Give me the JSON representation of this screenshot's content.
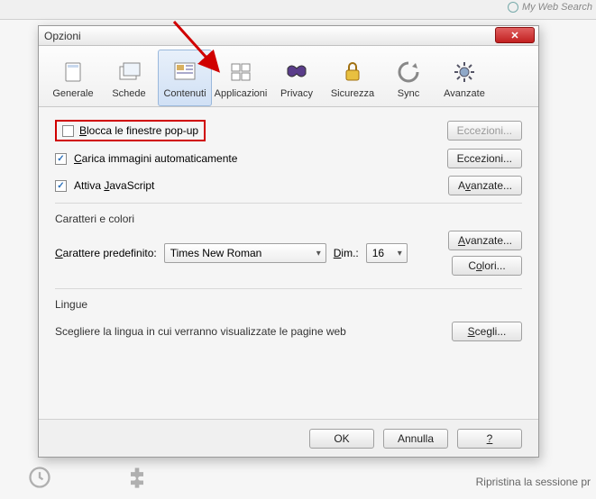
{
  "search_hint": "My Web Search",
  "dialog": {
    "title": "Opzioni",
    "tabs": [
      {
        "label": "Generale"
      },
      {
        "label": "Schede"
      },
      {
        "label": "Contenuti"
      },
      {
        "label": "Applicazioni"
      },
      {
        "label": "Privacy"
      },
      {
        "label": "Sicurezza"
      },
      {
        "label": "Sync"
      },
      {
        "label": "Avanzate"
      }
    ],
    "selected_tab_index": 2,
    "content": {
      "block_popups": {
        "label": "Blocca le finestre pop-up",
        "checked": false,
        "button": "Eccezioni..."
      },
      "load_images": {
        "label": "Carica immagini automaticamente",
        "checked": true,
        "button": "Eccezioni..."
      },
      "enable_js": {
        "label": "Attiva JavaScript",
        "checked": true,
        "button": "Avanzate..."
      },
      "fonts_section": {
        "title": "Caratteri e colori",
        "default_font_label": "Carattere predefinito:",
        "default_font_value": "Times New Roman",
        "size_label": "Dim.:",
        "size_value": "16",
        "advanced_button": "Avanzate...",
        "colors_button": "Colori..."
      },
      "languages_section": {
        "title": "Lingue",
        "description": "Scegliere la lingua in cui verranno visualizzate le pagine web",
        "choose_button": "Scegli..."
      }
    },
    "buttons": {
      "ok": "OK",
      "cancel": "Annulla",
      "help": "?"
    }
  },
  "status_bar": {
    "restore": "Ripristina la sessione pr"
  }
}
